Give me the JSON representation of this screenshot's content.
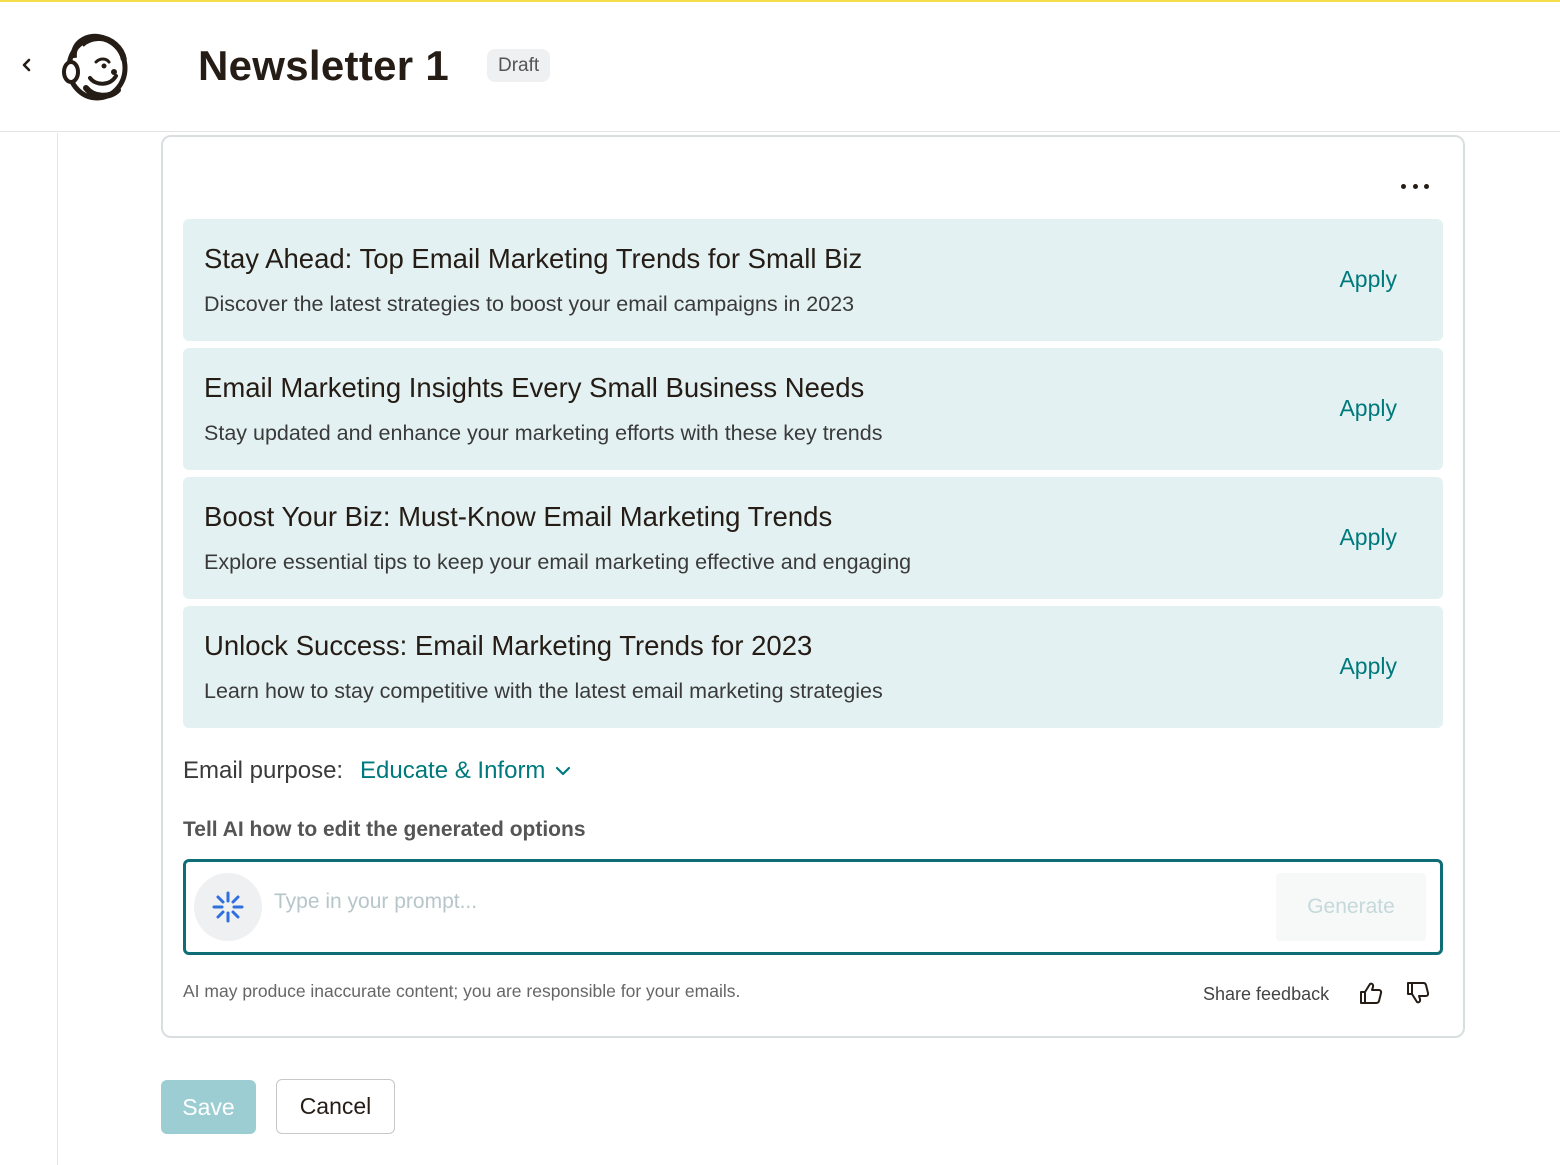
{
  "header": {
    "title": "Newsletter 1",
    "status_badge": "Draft"
  },
  "options": [
    {
      "title": "Stay Ahead: Top Email Marketing Trends for Small Biz",
      "description": "Discover the latest strategies to boost your email campaigns in 2023",
      "action": "Apply"
    },
    {
      "title": "Email Marketing Insights Every Small Business Needs",
      "description": "Stay updated and enhance your marketing efforts with these key trends",
      "action": "Apply"
    },
    {
      "title": "Boost Your Biz: Must-Know Email Marketing Trends",
      "description": "Explore essential tips to keep your email marketing effective and engaging",
      "action": "Apply"
    },
    {
      "title": "Unlock Success: Email Marketing Trends for 2023",
      "description": "Learn how to stay competitive with the latest email marketing strategies",
      "action": "Apply"
    }
  ],
  "purpose": {
    "label": "Email purpose:",
    "value": "Educate & Inform"
  },
  "prompt": {
    "label": "Tell AI how to edit the generated options",
    "placeholder": "Type in your prompt...",
    "value": "",
    "generate_label": "Generate"
  },
  "footer": {
    "disclaimer": "AI may produce inaccurate content; you are responsible for your emails.",
    "feedback_label": "Share feedback"
  },
  "actions": {
    "save_label": "Save",
    "cancel_label": "Cancel"
  },
  "colors": {
    "accent": "#00797c",
    "option_bg": "#e4f1f2",
    "prompt_border": "#0f6e75",
    "save_bg": "#9ccdd2",
    "ai_icon": "#2f6fde",
    "top_stripe": "#f5dd4b"
  },
  "icons": {
    "back": "chevron-left-icon",
    "logo": "mailchimp-logo",
    "more": "more-horizontal-icon",
    "purpose_dropdown": "chevron-down-icon",
    "ai": "sparkle-icon",
    "thumbs_up": "thumbs-up-icon",
    "thumbs_down": "thumbs-down-icon"
  }
}
